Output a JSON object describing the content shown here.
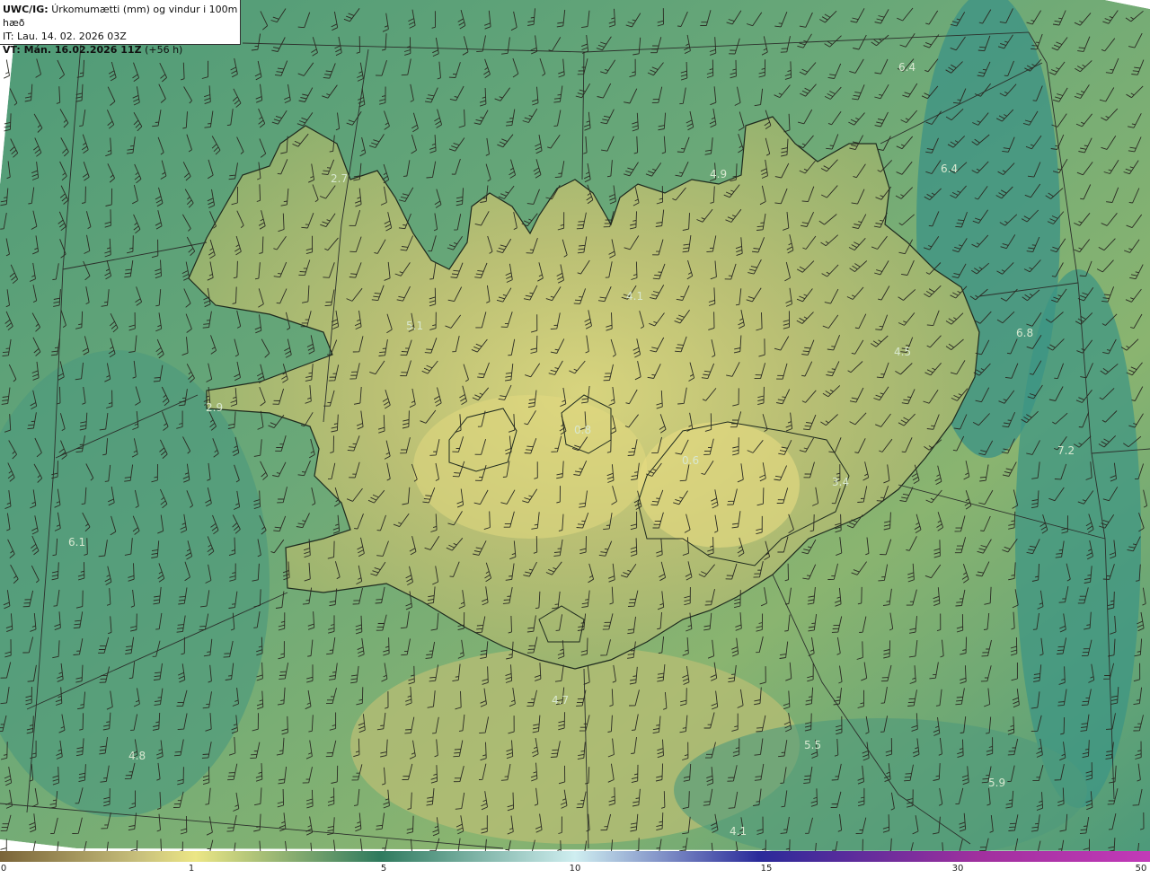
{
  "header": {
    "line1_bold": "UWC/IG:",
    "line1_rest": "Úrkomumætti (mm) og vindur i 100m hæð",
    "line2": "IT: Lau. 14. 02. 2026 03Z",
    "line3_bold": "VT: Mán. 16.02.2026 11Z",
    "line3_rest": "(+56 h)"
  },
  "colorbar": {
    "ticks": [
      {
        "label": "0",
        "value": 0
      },
      {
        "label": "1",
        "value": 1
      },
      {
        "label": "5",
        "value": 5
      },
      {
        "label": "10",
        "value": 10
      },
      {
        "label": "15",
        "value": 15
      },
      {
        "label": "30",
        "value": 30
      },
      {
        "label": "50",
        "value": 50
      }
    ],
    "colors": [
      "#7a6438",
      "#c7c078",
      "#ece685",
      "#2f7a5e",
      "#cfeef0",
      "#2a2a9a",
      "#a0309e",
      "#c23ab8"
    ]
  },
  "map_values": [
    {
      "text": "6.4",
      "id": "v1"
    },
    {
      "text": "6.4",
      "id": "v2"
    },
    {
      "text": "4.9",
      "id": "v3"
    },
    {
      "text": "2.7",
      "id": "v4"
    },
    {
      "text": "4.1",
      "id": "v5"
    },
    {
      "text": "5.1",
      "id": "v6"
    },
    {
      "text": "6.8",
      "id": "v7"
    },
    {
      "text": "4.5",
      "id": "v8"
    },
    {
      "text": "2.9",
      "id": "v9"
    },
    {
      "text": "0.8",
      "id": "v10"
    },
    {
      "text": "7.2",
      "id": "v11"
    },
    {
      "text": "0.6",
      "id": "v12"
    },
    {
      "text": "3.4",
      "id": "v13"
    },
    {
      "text": "6.1",
      "id": "v14"
    },
    {
      "text": "4.7",
      "id": "v15"
    },
    {
      "text": "5.5",
      "id": "v16"
    },
    {
      "text": "4.8",
      "id": "v17"
    },
    {
      "text": "5.9",
      "id": "v18"
    },
    {
      "text": "4.1",
      "id": "v19"
    }
  ],
  "icons": [
    "wind-barb-icon"
  ]
}
